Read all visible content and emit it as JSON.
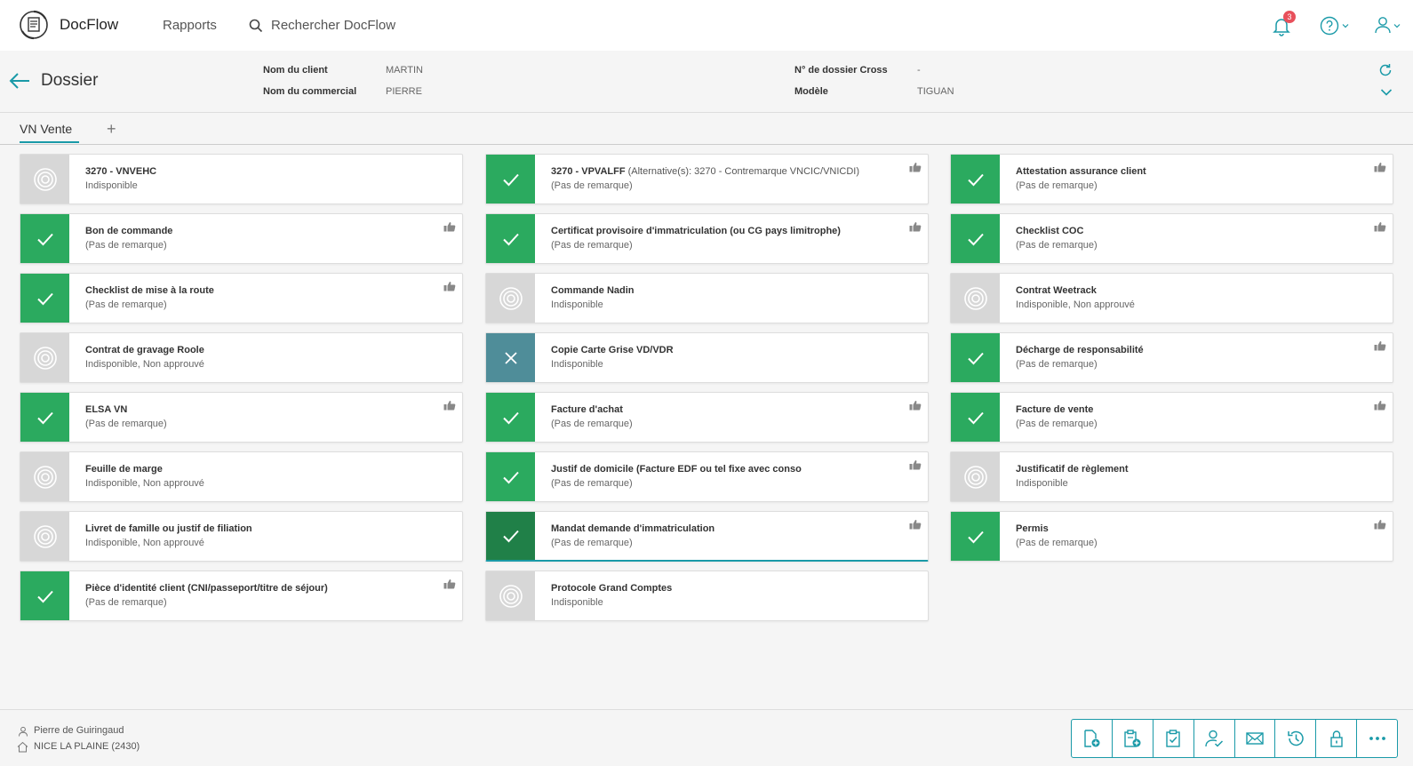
{
  "app": {
    "name": "DocFlow",
    "nav_reports": "Rapports",
    "search_label": "Rechercher DocFlow",
    "notifications_count": "3"
  },
  "header": {
    "title": "Dossier",
    "fields": [
      {
        "label": "Nom du client",
        "value": "MARTIN"
      },
      {
        "label": "Nom du commercial",
        "value": "PIERRE"
      },
      {
        "label": "N° de dossier Cross",
        "value": "-"
      },
      {
        "label": "Modèle",
        "value": "TIGUAN"
      }
    ]
  },
  "tabs": [
    {
      "label": "VN Vente"
    }
  ],
  "tab_add": "+",
  "documents": [
    {
      "title": "3270 - VNVEHC",
      "alt": "",
      "remark": "Indisponible",
      "status": "unavailable",
      "approved": false
    },
    {
      "title": "3270 - VPVALFF",
      "alt": "(Alternative(s): 3270 - Contremarque VNCIC/VNICDI)",
      "remark": "(Pas de remarque)",
      "status": "valid",
      "approved": true
    },
    {
      "title": "Attestation assurance client",
      "alt": "",
      "remark": "(Pas de remarque)",
      "status": "valid",
      "approved": true
    },
    {
      "title": "Bon de commande",
      "alt": "",
      "remark": "(Pas de remarque)",
      "status": "valid",
      "approved": true
    },
    {
      "title": "Certificat provisoire d'immatriculation (ou CG pays limitrophe)",
      "alt": "",
      "remark": "(Pas de remarque)",
      "status": "valid",
      "approved": true
    },
    {
      "title": "Checklist COC",
      "alt": "",
      "remark": "(Pas de remarque)",
      "status": "valid",
      "approved": true
    },
    {
      "title": "Checklist de mise à la route",
      "alt": "",
      "remark": "(Pas de remarque)",
      "status": "valid",
      "approved": true
    },
    {
      "title": "Commande Nadin",
      "alt": "",
      "remark": "Indisponible",
      "status": "unavailable",
      "approved": false
    },
    {
      "title": "Contrat Weetrack",
      "alt": "",
      "remark": "Indisponible, Non approuvé",
      "status": "unavailable",
      "approved": false
    },
    {
      "title": "Contrat de gravage Roole",
      "alt": "",
      "remark": "Indisponible, Non approuvé",
      "status": "unavailable",
      "approved": false
    },
    {
      "title": "Copie Carte Grise VD/VDR",
      "alt": "",
      "remark": "Indisponible",
      "status": "rejected",
      "approved": false
    },
    {
      "title": "Décharge de responsabilité",
      "alt": "",
      "remark": "(Pas de remarque)",
      "status": "valid",
      "approved": true
    },
    {
      "title": "ELSA VN",
      "alt": "",
      "remark": "(Pas de remarque)",
      "status": "valid",
      "approved": true
    },
    {
      "title": "Facture d'achat",
      "alt": "",
      "remark": "(Pas de remarque)",
      "status": "valid",
      "approved": true
    },
    {
      "title": "Facture de vente",
      "alt": "",
      "remark": "(Pas de remarque)",
      "status": "valid",
      "approved": true
    },
    {
      "title": "Feuille de marge",
      "alt": "",
      "remark": "Indisponible, Non approuvé",
      "status": "unavailable",
      "approved": false
    },
    {
      "title": "Justif de domicile (Facture EDF ou tel fixe avec conso",
      "alt": "",
      "remark": "(Pas de remarque)",
      "status": "valid",
      "approved": true
    },
    {
      "title": "Justificatif de règlement",
      "alt": "",
      "remark": "Indisponible",
      "status": "unavailable",
      "approved": false
    },
    {
      "title": "Livret de famille ou justif de filiation",
      "alt": "",
      "remark": "Indisponible, Non approuvé",
      "status": "unavailable",
      "approved": false
    },
    {
      "title": "Mandat demande d'immatriculation",
      "alt": "",
      "remark": "(Pas de remarque)",
      "status": "valid-selected",
      "approved": true
    },
    {
      "title": "Permis",
      "alt": "",
      "remark": "(Pas de remarque)",
      "status": "valid",
      "approved": true
    },
    {
      "title": "Pièce d'identité client (CNI/passeport/titre de séjour)",
      "alt": "",
      "remark": "(Pas de remarque)",
      "status": "valid",
      "approved": true
    },
    {
      "title": "Protocole Grand Comptes",
      "alt": "",
      "remark": "Indisponible",
      "status": "unavailable",
      "approved": false
    }
  ],
  "footer": {
    "user": "Pierre de Guiringaud",
    "location": "NICE LA PLAINE (2430)"
  },
  "actions": [
    {
      "icon": "add-document-icon"
    },
    {
      "icon": "add-clipboard-icon"
    },
    {
      "icon": "clipboard-check-icon"
    },
    {
      "icon": "user-check-icon"
    },
    {
      "icon": "mail-icon"
    },
    {
      "icon": "history-icon"
    },
    {
      "icon": "lock-icon"
    },
    {
      "icon": "more-icon"
    }
  ],
  "colors": {
    "accent": "#1a9aa8",
    "valid": "#2baa5f",
    "valid_selected": "#208048",
    "unavailable": "#d7d7d7",
    "rejected": "#4f8d99",
    "badge": "#e8505b"
  }
}
